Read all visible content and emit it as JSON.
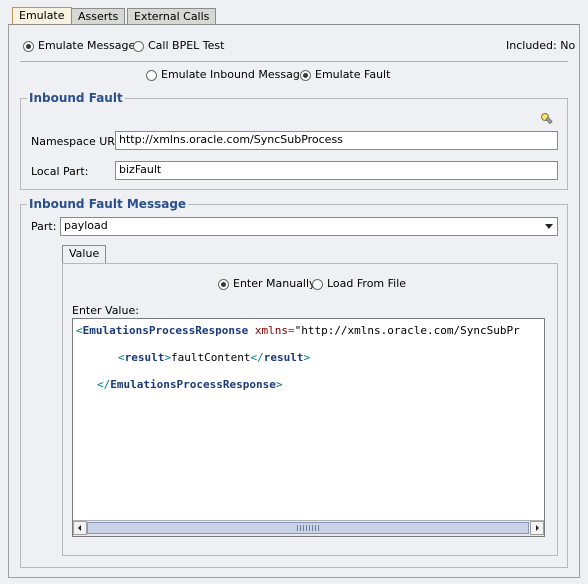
{
  "tabs": [
    {
      "label": "Emulate",
      "active": true
    },
    {
      "label": "Asserts",
      "active": false
    },
    {
      "label": "External Calls",
      "active": false
    }
  ],
  "mode": {
    "emulate_message": "Emulate Message",
    "call_bpel_test": "Call BPEL Test",
    "selected": "emulate_message",
    "included": "Included: No"
  },
  "emulate_type": {
    "inbound_message": "Emulate Inbound Message",
    "fault": "Emulate Fault",
    "selected": "fault"
  },
  "inbound_fault": {
    "title": "Inbound Fault",
    "icon": "flashlight-icon",
    "namespace_label": "Namespace URI:",
    "namespace_value": "http://xmlns.oracle.com/SyncSubProcess",
    "local_part_label": "Local Part:",
    "local_part_value": "bizFault"
  },
  "fault_message": {
    "title": "Inbound Fault Message",
    "part_label": "Part:",
    "part_value": "payload",
    "value_tab": "Value",
    "enter_manually": "Enter Manually",
    "load_from_file": "Load From File",
    "selected_source": "enter_manually",
    "enter_value_label": "Enter Value:",
    "code": {
      "line1_tag": "EmulationsProcessResponse",
      "line1_attr": "xmlns",
      "line1_value": "\"http://xmlns.oracle.com/SyncSubPr",
      "line2_tag": "result",
      "line2_text": "faultContent",
      "line3_tag": "EmulationsProcessResponse"
    }
  }
}
